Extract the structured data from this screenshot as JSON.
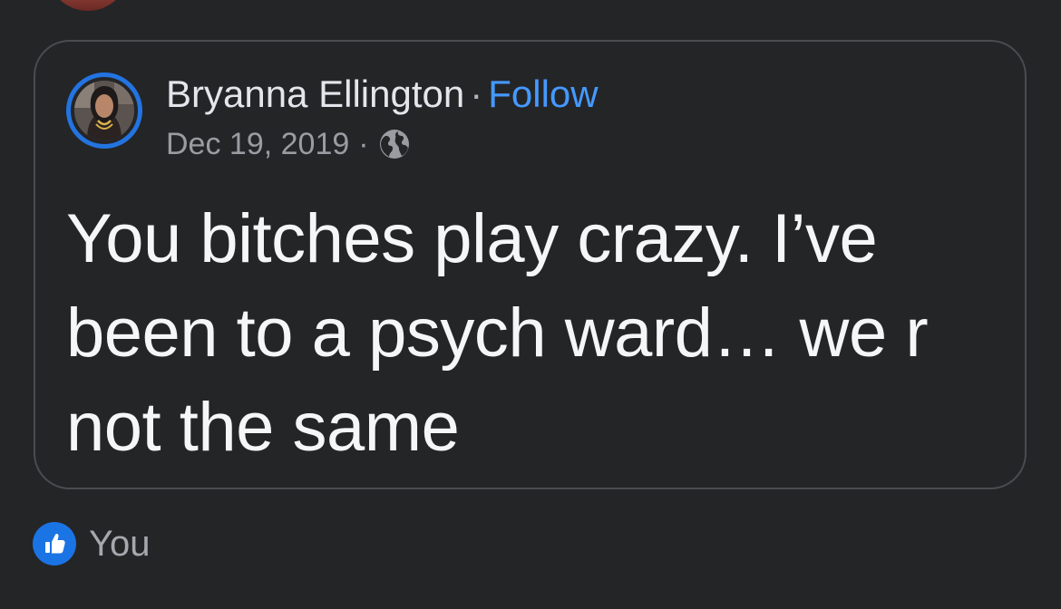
{
  "post": {
    "author_name": "Bryanna Ellington",
    "separator": "·",
    "follow_label": "Follow",
    "date": "Dec 19, 2019",
    "meta_separator": "·",
    "privacy_icon": "globe-icon",
    "body": "You bitches play crazy. I’ve been to a psych ward… we r not the same"
  },
  "reactions": {
    "icon": "like-icon",
    "label": "You"
  },
  "colors": {
    "background": "#242527",
    "card_border": "#4a4c50",
    "accent": "#4599ff",
    "avatar_ring": "#2374e1",
    "like_badge": "#1b74e4"
  }
}
